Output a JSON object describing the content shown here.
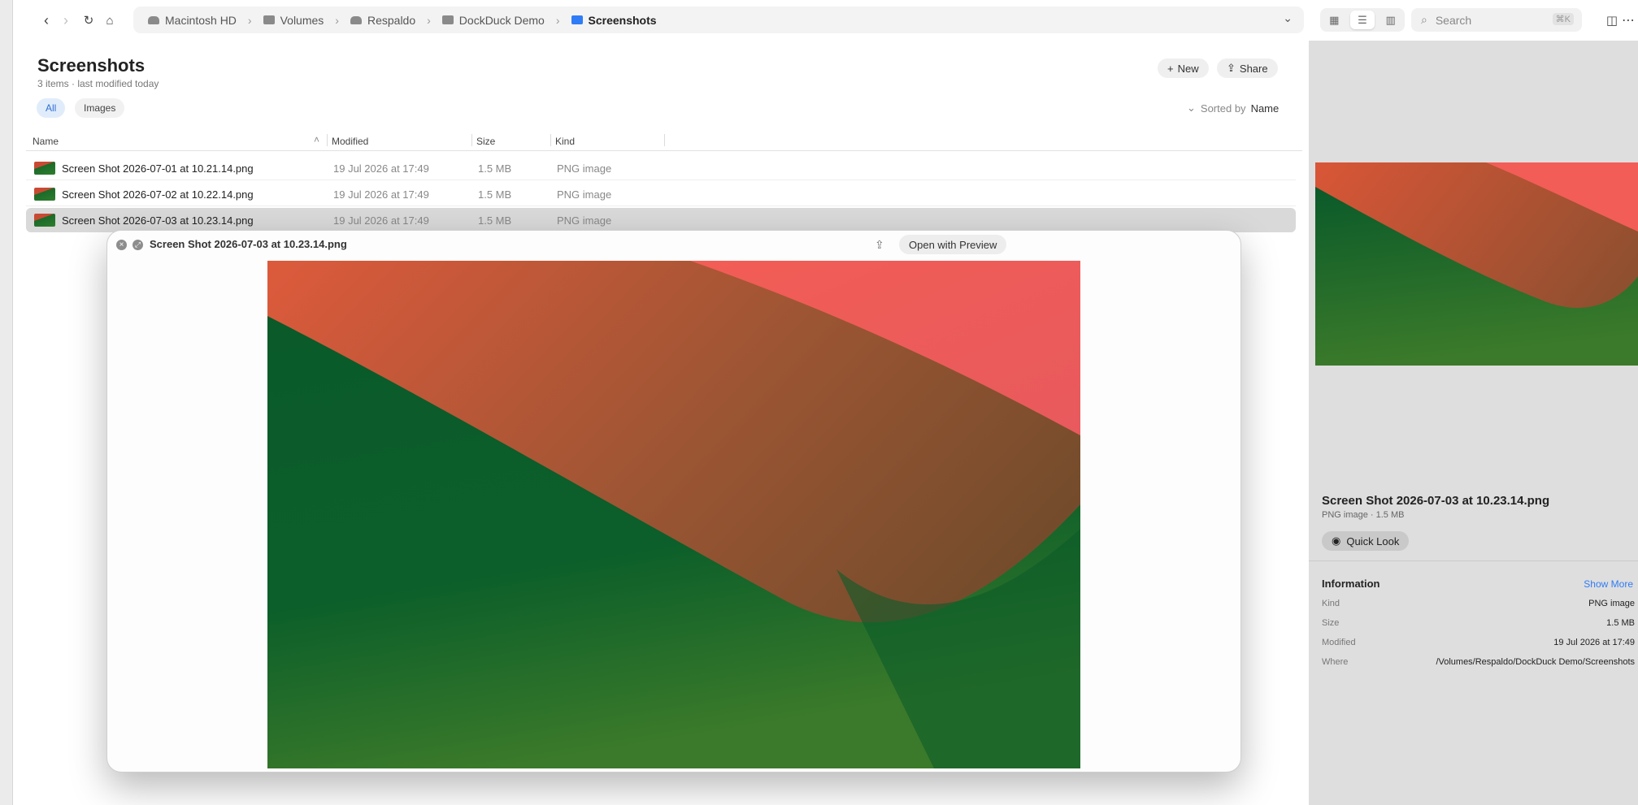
{
  "path": {
    "crumbs": [
      "Macintosh HD",
      "Volumes",
      "Respaldo",
      "DockDuck Demo",
      "Screenshots"
    ]
  },
  "search": {
    "placeholder": "Search",
    "shortcut": "⌘K"
  },
  "header": {
    "title": "Screenshots",
    "subtitle": "3 items · last modified today",
    "new_label": "New",
    "share_label": "Share"
  },
  "filters": [
    "All",
    "Images"
  ],
  "sort": {
    "label": "Sorted by",
    "value": "Name"
  },
  "columns": [
    "Name",
    "Modified",
    "Size",
    "Kind"
  ],
  "files": [
    {
      "name": "Screen Shot 2026-07-01 at 10.21.14.png",
      "modified": "19 Jul 2026 at 17:49",
      "size": "1.5 MB",
      "kind": "PNG image"
    },
    {
      "name": "Screen Shot 2026-07-02 at 10.22.14.png",
      "modified": "19 Jul 2026 at 17:49",
      "size": "1.5 MB",
      "kind": "PNG image"
    },
    {
      "name": "Screen Shot 2026-07-03 at 10.23.14.png",
      "modified": "19 Jul 2026 at 17:49",
      "size": "1.5 MB",
      "kind": "PNG image"
    }
  ],
  "quicklook": {
    "title": "Screen Shot 2026-07-03 at 10.23.14.png",
    "open_label": "Open with Preview"
  },
  "inspector": {
    "name": "Screen Shot 2026-07-03 at 10.23.14.png",
    "meta": "PNG image · 1.5 MB",
    "quicklook_label": "Quick Look",
    "info_title": "Information",
    "show_more": "Show More",
    "rows": [
      {
        "k": "Kind",
        "v": "PNG image"
      },
      {
        "k": "Size",
        "v": "1.5 MB"
      },
      {
        "k": "Modified",
        "v": "19 Jul 2026 at 17:49"
      },
      {
        "k": "Where",
        "v": "/Volumes/Respaldo/DockDuck Demo/Screenshots"
      }
    ]
  },
  "colors": {
    "accent": "#2f7cf6",
    "selection": "#d9d9d9",
    "wallpaper_red": "#e8594a",
    "wallpaper_green": "#0b5e2a"
  }
}
